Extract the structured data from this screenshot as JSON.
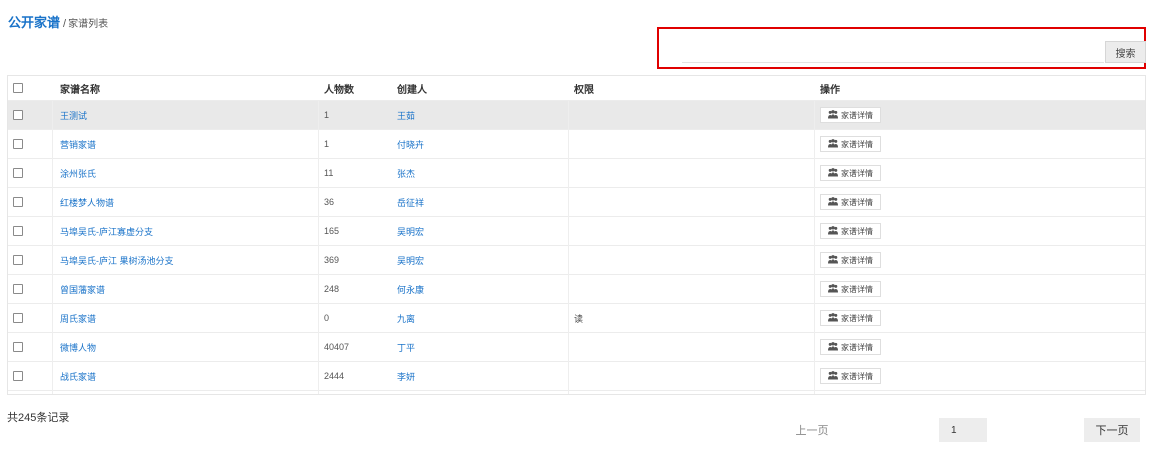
{
  "breadcrumb": {
    "title": "公开家谱",
    "separator": "/",
    "current": "家谱列表"
  },
  "search": {
    "value": "",
    "placeholder": "",
    "button_label": "搜索"
  },
  "table": {
    "headers": {
      "name": "家谱名称",
      "people": "人物数",
      "creator": "创建人",
      "permission": "权限",
      "action": "操作"
    },
    "rows": [
      {
        "name": "王测试",
        "people": "1",
        "creator": "王茹",
        "permission": "",
        "action": "家谱详情"
      },
      {
        "name": "营销家谱",
        "people": "1",
        "creator": "付晓卉",
        "permission": "",
        "action": "家谱详情"
      },
      {
        "name": "涂州张氏",
        "people": "11",
        "creator": "张杰",
        "permission": "",
        "action": "家谱详情"
      },
      {
        "name": "红楼梦人物谱",
        "people": "36",
        "creator": "岳征祥",
        "permission": "",
        "action": "家谱详情"
      },
      {
        "name": "马埠吴氏-庐江寡虚分支",
        "people": "165",
        "creator": "吴明宏",
        "permission": "",
        "action": "家谱详情"
      },
      {
        "name": "马埠吴氏-庐江 果树汤池分支",
        "people": "369",
        "creator": "吴明宏",
        "permission": "",
        "action": "家谱详情"
      },
      {
        "name": "曾国藩家谱",
        "people": "248",
        "creator": "何永康",
        "permission": "",
        "action": "家谱详情"
      },
      {
        "name": "周氏家谱",
        "people": "0",
        "creator": "九离",
        "permission": "读",
        "action": "家谱详情"
      },
      {
        "name": "微博人物",
        "people": "40407",
        "creator": "丁平",
        "permission": "",
        "action": "家谱详情"
      },
      {
        "name": "战氏家谱",
        "people": "2444",
        "creator": "李妍",
        "permission": "",
        "action": "家谱详情"
      }
    ]
  },
  "footer": {
    "record_count": "共245条记录",
    "prev_label": "上一页",
    "page_number": "1",
    "next_label": "下一页"
  },
  "icons": {
    "action_icon": "family-icon"
  },
  "colors": {
    "link": "#1a73c9",
    "highlight_border": "#e00000",
    "selected_row": "#e9e9e9"
  }
}
